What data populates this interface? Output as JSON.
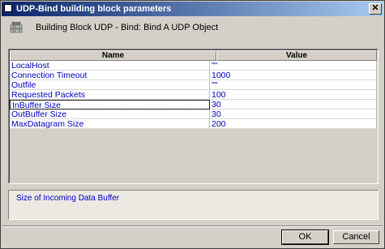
{
  "window": {
    "title": "UDP-Bind building block parameters"
  },
  "header": {
    "text": "Building Block UDP - Bind: Bind A UDP Object",
    "icon": "network-block-icon"
  },
  "grid": {
    "columns": {
      "name": "Name",
      "value": "Value"
    },
    "selected_row": "InBuffer Size",
    "rows": [
      {
        "name": "LocalHost",
        "value": "\"\""
      },
      {
        "name": "Connection Timeout",
        "value": "1000"
      },
      {
        "name": "Outfile",
        "value": "\"\""
      },
      {
        "name": "Requested Packets",
        "value": "100"
      },
      {
        "name": "InBuffer Size",
        "value": "30"
      },
      {
        "name": "OutBuffer Size",
        "value": "30"
      },
      {
        "name": "MaxDatagram Size",
        "value": "200"
      }
    ]
  },
  "description": {
    "text": "Size of Incoming Data Buffer"
  },
  "buttons": {
    "ok": "OK",
    "cancel": "Cancel"
  },
  "colors": {
    "titlebar_start": "#0a246a",
    "titlebar_end": "#a6caf0",
    "link_text": "#0000c0"
  }
}
